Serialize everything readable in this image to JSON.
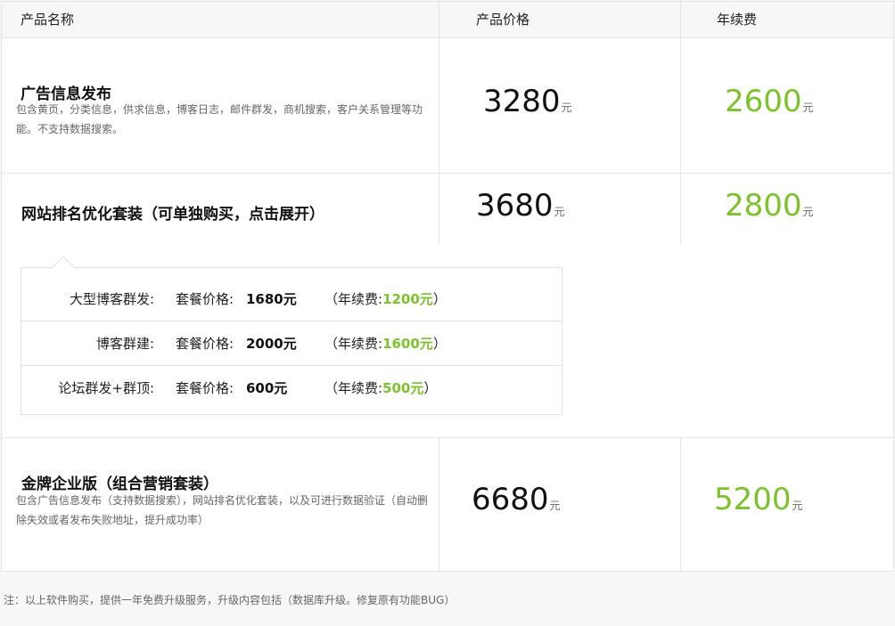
{
  "header": {
    "product_name": "产品名称",
    "product_price": "产品价格",
    "annual_fee": "年续费"
  },
  "products": [
    {
      "title": "广告信息发布",
      "description": "包含黄页，分类信息，供求信息，博客日志，邮件群发，商机搜索，客户关系管理等功能。不支持数据搜索。",
      "price": "3280",
      "price_unit": "元",
      "renew": "2600",
      "renew_unit": "元"
    },
    {
      "title": "网站排名优化套装（可单独购买，点击展开）",
      "price": "3680",
      "price_unit": "元",
      "renew": "2800",
      "renew_unit": "元"
    },
    {
      "title": "金牌企业版（组合营销套装）",
      "description": "包含广告信息发布（支持数据搜索），网站排名优化套装，以及可进行数据验证（自动删除失效或者发布失败地址，提升成功率）",
      "price": "6680",
      "price_unit": "元",
      "renew": "5200",
      "renew_unit": "元"
    }
  ],
  "packages": [
    {
      "name": "大型博客群发:",
      "price_label": "套餐价格:",
      "price": "1680元",
      "renew_prefix": "（年续费:",
      "renew": "1200元",
      "renew_suffix": "）"
    },
    {
      "name": "博客群建:",
      "price_label": "套餐价格:",
      "price": "2000元",
      "renew_prefix": "（年续费:",
      "renew": "1600元",
      "renew_suffix": "）"
    },
    {
      "name": "论坛群发+群顶:",
      "price_label": "套餐价格:",
      "price": "600元",
      "renew_prefix": "（年续费:",
      "renew": "500元",
      "renew_suffix": "）"
    }
  ],
  "footer": {
    "note": "注：以上软件购买，提供一年免费升级服务，升级内容包括（数据库升级。修复原有功能BUG）"
  },
  "colors": {
    "accent_green": "#7cc22c",
    "border": "#e3e3e3",
    "header_bg": "#f7f7f7"
  }
}
